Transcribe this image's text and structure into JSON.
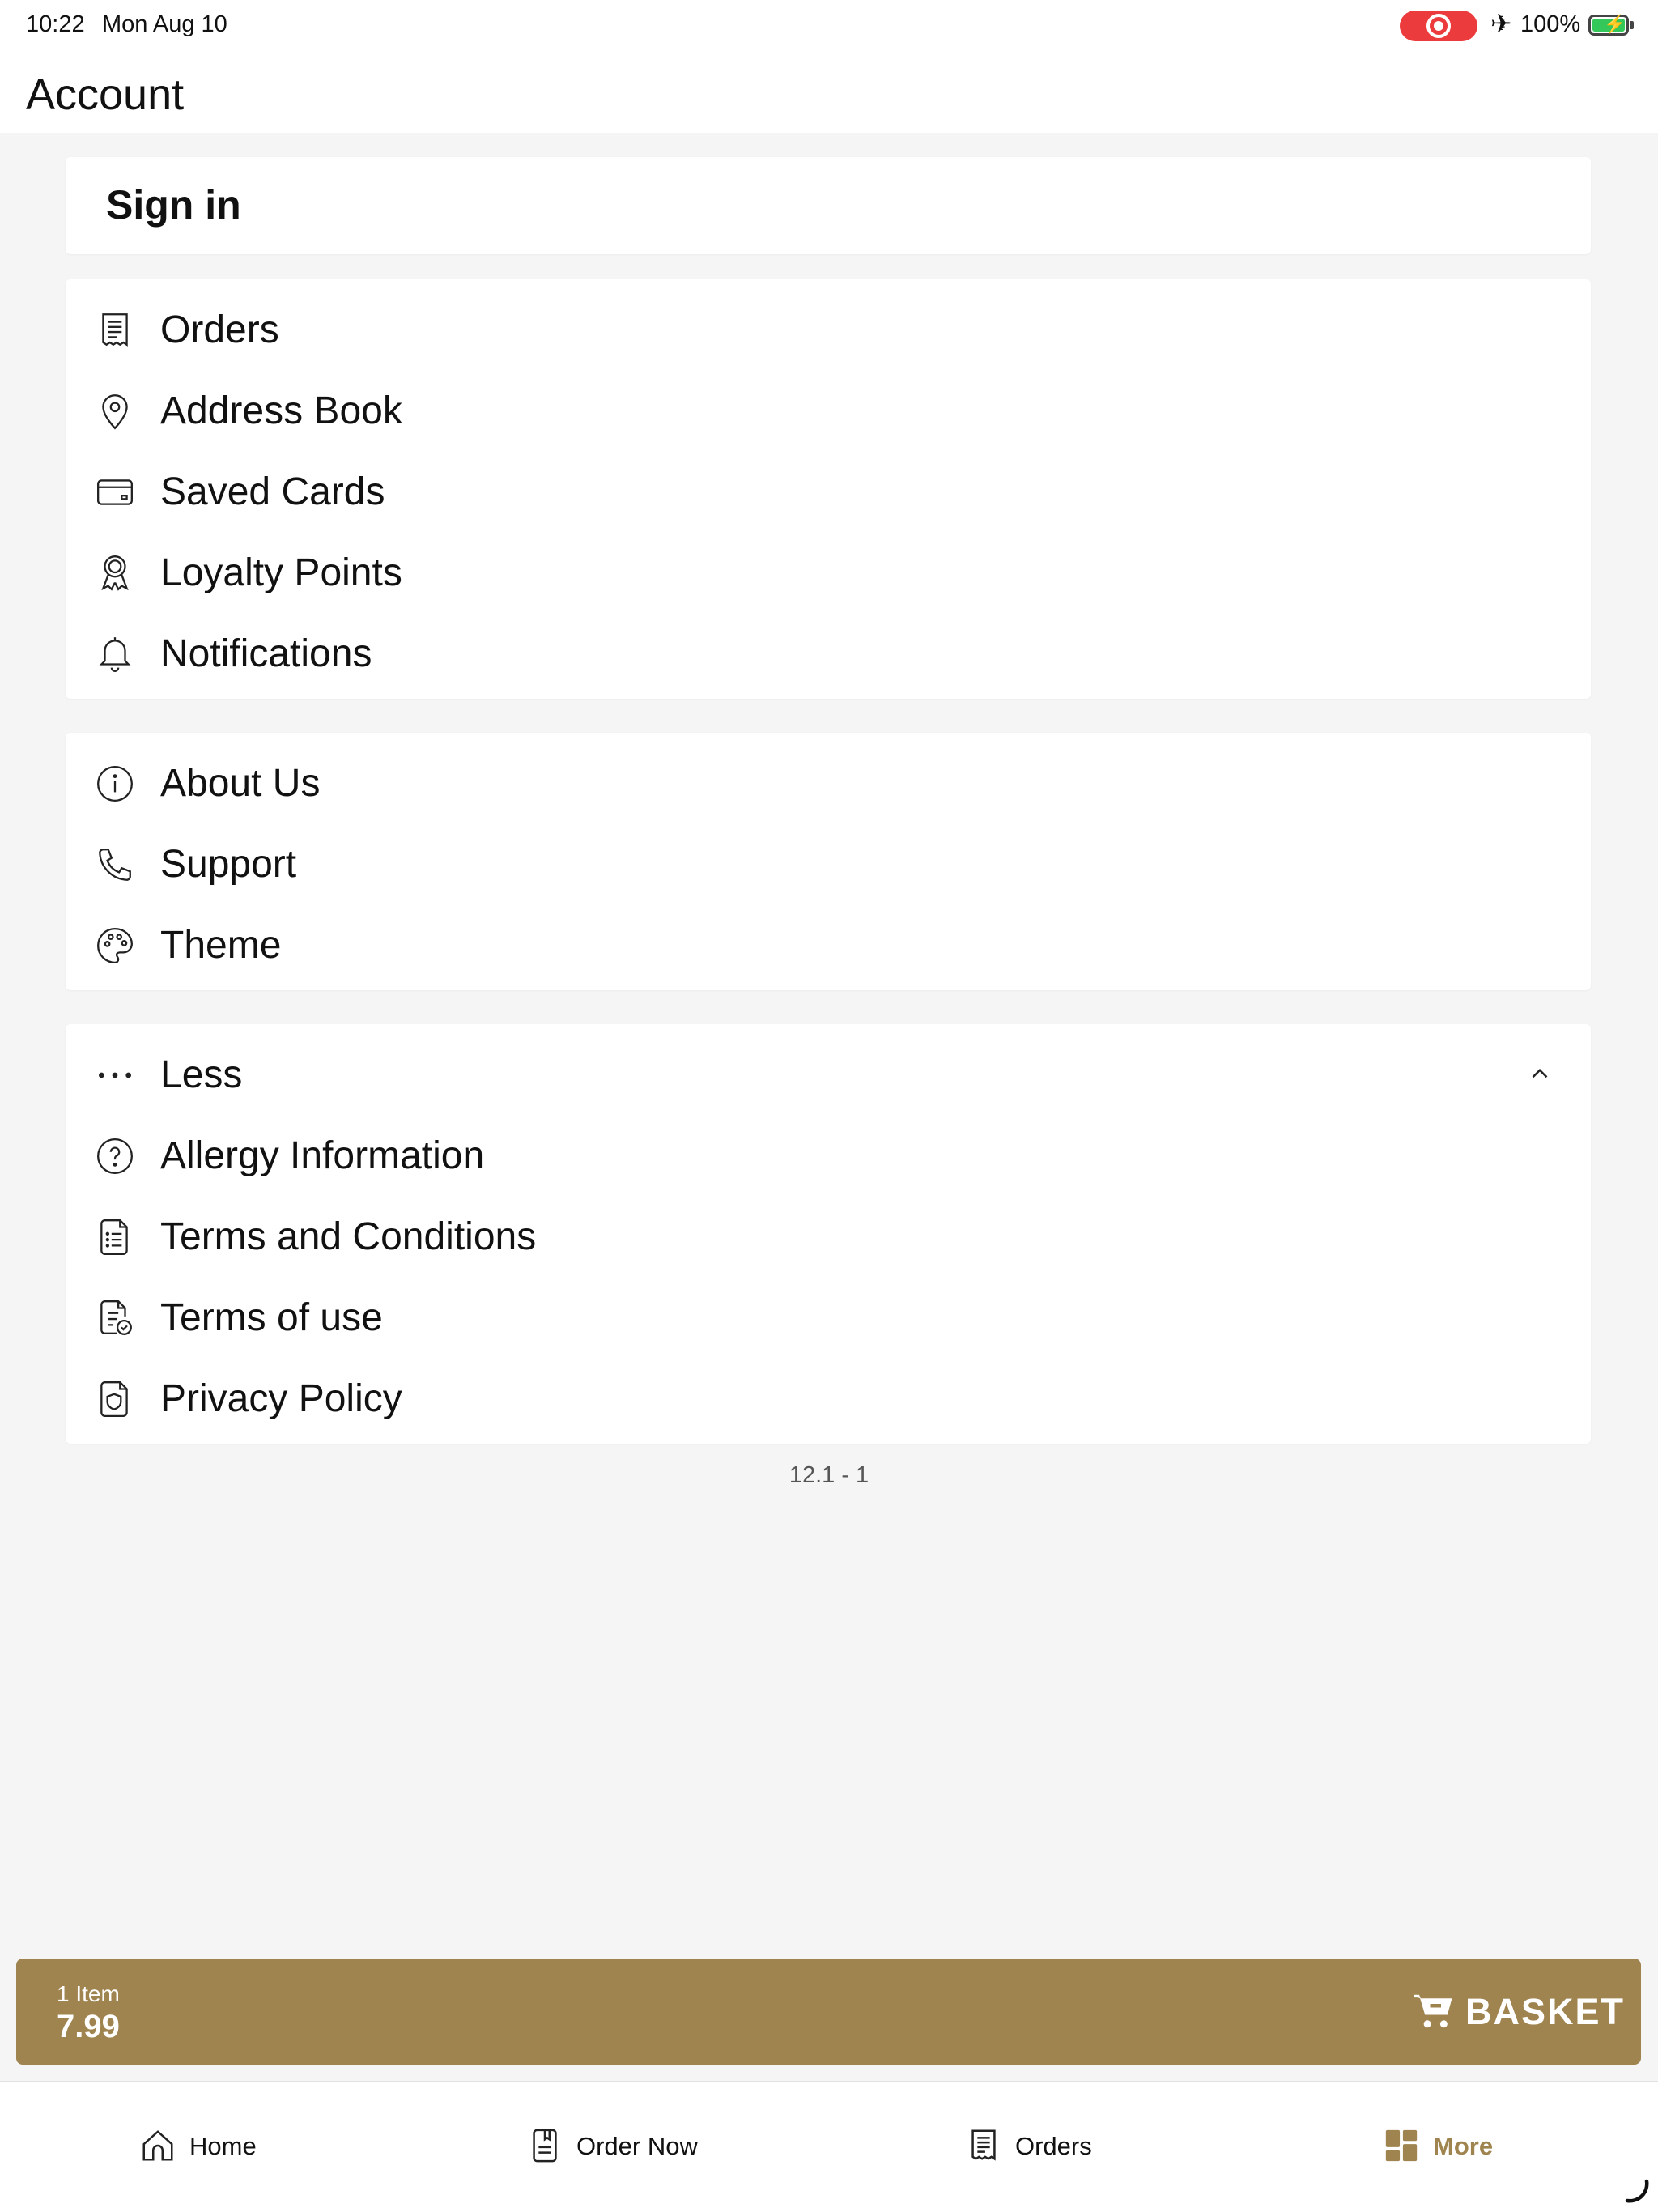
{
  "status_bar": {
    "time": "10:22",
    "date": "Mon Aug 10",
    "battery": "100%",
    "record_color": "#ec3b3d"
  },
  "header": {
    "title": "Account"
  },
  "sign_in": {
    "label": "Sign in"
  },
  "account_menu": [
    {
      "label": "Orders",
      "icon": "receipt-icon"
    },
    {
      "label": "Address Book",
      "icon": "map-pin-icon"
    },
    {
      "label": "Saved Cards",
      "icon": "credit-card-icon"
    },
    {
      "label": "Loyalty Points",
      "icon": "award-icon"
    },
    {
      "label": "Notifications",
      "icon": "bell-icon"
    }
  ],
  "info_menu": [
    {
      "label": "About Us",
      "icon": "info-icon"
    },
    {
      "label": "Support",
      "icon": "phone-icon"
    },
    {
      "label": "Theme",
      "icon": "palette-icon"
    }
  ],
  "more_menu": {
    "toggle_label": "Less",
    "toggle_icon": "chevron-up-icon",
    "items": [
      {
        "label": "Allergy Information",
        "icon": "question-circle-icon"
      },
      {
        "label": "Terms and Conditions",
        "icon": "document-list-icon"
      },
      {
        "label": "Terms of use",
        "icon": "document-check-icon"
      },
      {
        "label": "Privacy Policy",
        "icon": "shield-document-icon"
      }
    ]
  },
  "version": "12.1 - 1",
  "basket": {
    "item_count": "1 Item",
    "total": "7.99",
    "label": "BASKET",
    "color": "#9f844f"
  },
  "tab_bar": {
    "active_color": "#9f844f",
    "tabs": [
      {
        "label": "Home",
        "icon": "home-icon"
      },
      {
        "label": "Order Now",
        "icon": "menu-book-icon"
      },
      {
        "label": "Orders",
        "icon": "receipt-icon"
      },
      {
        "label": "More",
        "icon": "grid-icon",
        "active": true
      }
    ]
  }
}
